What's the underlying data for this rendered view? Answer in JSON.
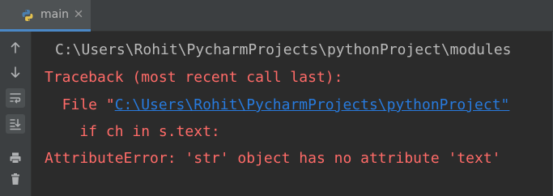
{
  "tab": {
    "label": "main",
    "icon": "python-icon",
    "close_icon": "close-icon"
  },
  "toolbar": {
    "items": [
      {
        "name": "up-arrow-icon",
        "label": "Up"
      },
      {
        "name": "down-arrow-icon",
        "label": "Down"
      },
      {
        "name": "soft-wrap-icon",
        "label": "Soft-Wrap"
      },
      {
        "name": "scroll-to-end-icon",
        "label": "Scroll to the end"
      },
      {
        "name": "print-icon",
        "label": "Print"
      },
      {
        "name": "trash-icon",
        "label": "Clear All"
      }
    ]
  },
  "console": {
    "lines": [
      {
        "text": "C:\\Users\\Rohit\\PycharmProjects\\pythonProject\\modules"
      },
      {
        "text": "Traceback (most recent call last):"
      },
      {
        "prefix": "  File \"",
        "link": "C:\\Users\\Rohit\\PycharmProjects\\pythonProject\"",
        "suffix": ""
      },
      {
        "text": "    if ch in s.text:"
      },
      {
        "text": "AttributeError: 'str' object has no attribute 'text'"
      }
    ]
  },
  "colors": {
    "background": "#2b2b2b",
    "toolbar": "#3c3f41",
    "text": "#bbbbbb",
    "error": "#ff6b68",
    "link": "#287bde",
    "tab_accent": "#4a88c7"
  }
}
